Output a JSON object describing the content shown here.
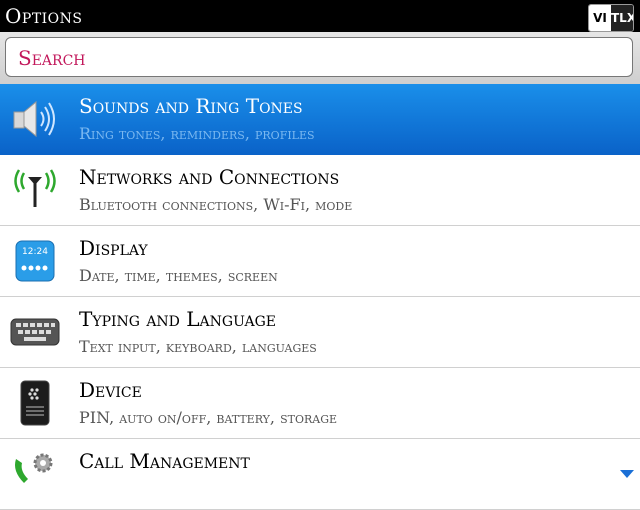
{
  "header": {
    "title": "Options",
    "badge_left": "VI",
    "badge_right": "TLX"
  },
  "search": {
    "placeholder": "Search"
  },
  "items": [
    {
      "title": "Sounds and Ring Tones",
      "subtitle": "Ring tones, reminders, profiles",
      "icon": "speaker-icon",
      "selected": true
    },
    {
      "title": "Networks and Connections",
      "subtitle": "Bluetooth connections, Wi-Fi, mode",
      "icon": "antenna-icon"
    },
    {
      "title": "Display",
      "subtitle": "Date, time, themes, screen",
      "icon": "display-icon",
      "clock": "12:24"
    },
    {
      "title": "Typing and Language",
      "subtitle": "Text input, keyboard, languages",
      "icon": "keyboard-icon"
    },
    {
      "title": "Device",
      "subtitle": "PIN, auto on/off, battery, storage",
      "icon": "device-icon"
    },
    {
      "title": "Call Management",
      "subtitle": "",
      "icon": "phone-gear-icon"
    }
  ],
  "colors": {
    "selected": "#0a62c8",
    "search_text": "#c2185b"
  }
}
